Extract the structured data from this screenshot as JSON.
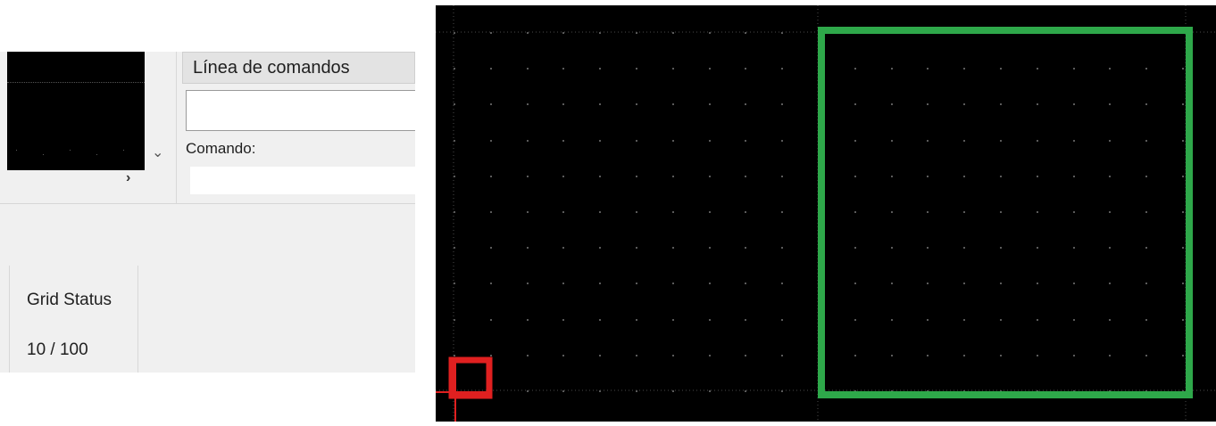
{
  "command_panel": {
    "title": "Línea de comandos",
    "history_text": "",
    "prompt_label": "Comando:",
    "input_value": "",
    "input_placeholder": ""
  },
  "status_panel": {
    "grid_label": "Grid Status",
    "grid_value": "10 / 100"
  },
  "navigator": {
    "expand_icon": "chevron-down-icon",
    "scroll_icon": "chevron-right-icon",
    "scroll_glyph": "›"
  },
  "canvas": {
    "background": "#000000",
    "grid_dot_color": "#5a5a5a",
    "selection_color": "#2ea84a",
    "cursor_color": "#e02020",
    "cursor_icon": "crosshair-cursor-icon"
  }
}
